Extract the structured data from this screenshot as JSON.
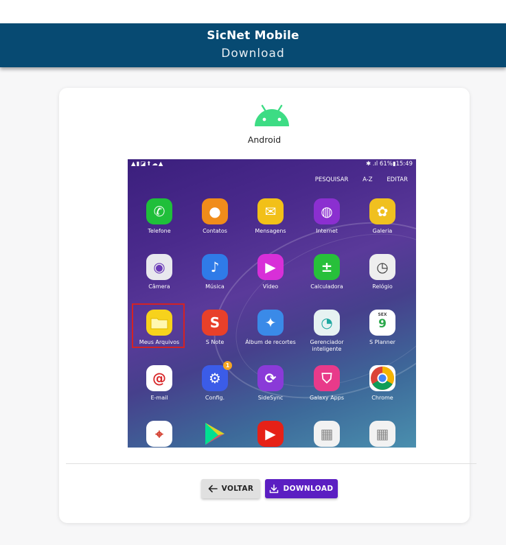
{
  "header": {
    "title": "SicNet Mobile",
    "subtitle": "Download"
  },
  "platform": {
    "label": "Android",
    "logo_color": "#3ddc84",
    "logo_icon": "android-icon"
  },
  "phone": {
    "status_left": "▲▮◪⬆☁▲",
    "status_right": "✱ .ıl 61%▮15:49",
    "menu": [
      "PESQUISAR",
      "A-Z",
      "EDITAR"
    ],
    "apps": [
      {
        "label": "Telefone",
        "icon": "phone-icon",
        "color": "#1fbf3a"
      },
      {
        "label": "Contatos",
        "icon": "contacts-icon",
        "color": "#f08c1a"
      },
      {
        "label": "Mensagens",
        "icon": "messages-icon",
        "color": "#f2c018"
      },
      {
        "label": "Internet",
        "icon": "internet-icon",
        "color": "#8b2fd0"
      },
      {
        "label": "Galeria",
        "icon": "gallery-icon",
        "color": "#f0c020"
      },
      {
        "label": "Câmera",
        "icon": "camera-icon",
        "color": "#e8e8ee"
      },
      {
        "label": "Música",
        "icon": "music-icon",
        "color": "#2f7be8"
      },
      {
        "label": "Vídeo",
        "icon": "video-icon",
        "color": "#d82fd8"
      },
      {
        "label": "Calculadora",
        "icon": "calculator-icon",
        "color": "#27c03a"
      },
      {
        "label": "Relógio",
        "icon": "clock-icon",
        "color": "#eeeeee"
      },
      {
        "label": "Meus Arquivos",
        "icon": "folder-icon",
        "color": "#f7d21c"
      },
      {
        "label": "S Note",
        "icon": "snote-icon",
        "color": "#e8402a"
      },
      {
        "label": "Álbum de recortes",
        "icon": "scrapbook-icon",
        "color": "#3a8ae8"
      },
      {
        "label": "Gerenciador inteligente",
        "icon": "smart-manager-icon",
        "color": "#e6f2f2"
      },
      {
        "label": "S Planner",
        "icon": "calendar-icon",
        "color": "#ffffff"
      },
      {
        "label": "E-mail",
        "icon": "email-icon",
        "color": "#ffffff"
      },
      {
        "label": "Config.",
        "icon": "settings-icon",
        "color": "#3b5ce8",
        "badge": "1"
      },
      {
        "label": "SideSync",
        "icon": "sidesync-icon",
        "color": "#8a3ad8"
      },
      {
        "label": "Galaxy Apps",
        "icon": "galaxy-apps-icon",
        "color": "#e83a8a"
      },
      {
        "label": "Chrome",
        "icon": "chrome-icon",
        "color": "#ffffff"
      },
      {
        "label": "",
        "icon": "maps-icon",
        "color": "#ffffff"
      },
      {
        "label": "",
        "icon": "play-store-icon",
        "color": "#00000000"
      },
      {
        "label": "",
        "icon": "youtube-icon",
        "color": "#e62117"
      },
      {
        "label": "",
        "icon": "google-folder-icon",
        "color": "#f2f2f2"
      },
      {
        "label": "",
        "icon": "microsoft-folder-icon",
        "color": "#f2f2f2"
      }
    ],
    "calendar_day": "SEX",
    "calendar_date": "9"
  },
  "actions": {
    "back_label": "VOLTAR",
    "download_label": "DOWNLOAD"
  },
  "colors": {
    "header_bg": "#074a72",
    "download_btn": "#5b1ec2",
    "highlight": "#d62222"
  }
}
